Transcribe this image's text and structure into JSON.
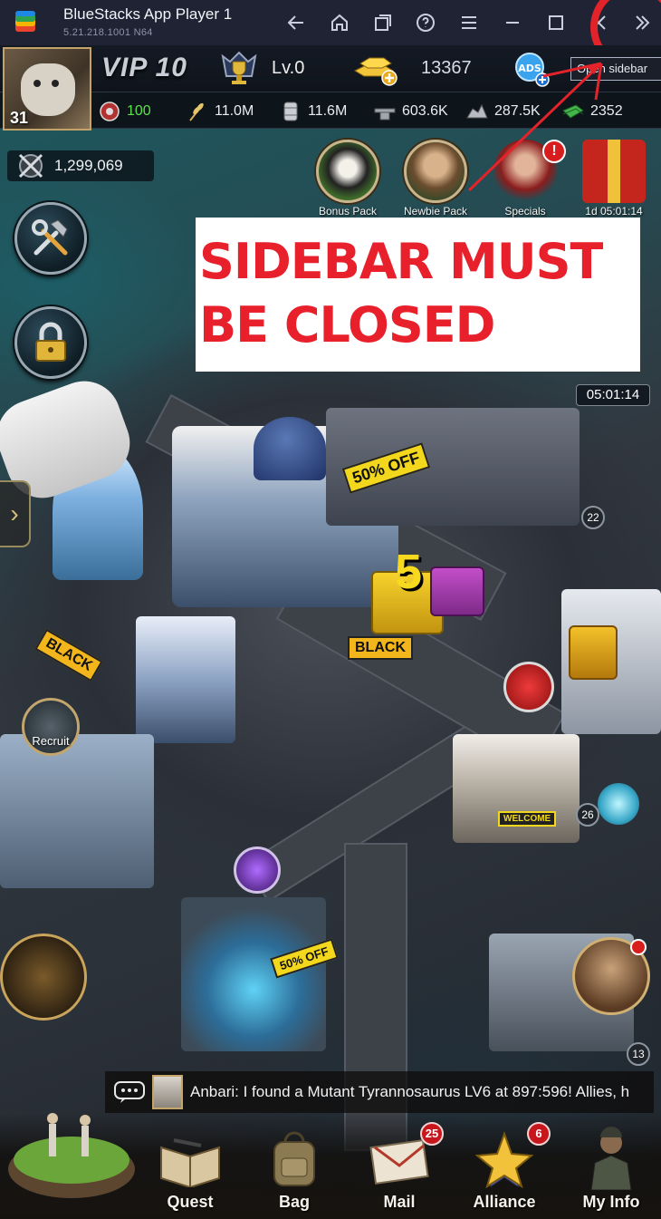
{
  "window": {
    "title": "BlueStacks App Player 1",
    "version": "5.21.218.1001  N64",
    "accent": "#1f2333"
  },
  "hud": {
    "avatar_level": "31",
    "vip": "VIP 10",
    "level": "Lv.0",
    "gold": "13367",
    "sidebar_tooltip": "Open sidebar"
  },
  "resources": [
    {
      "icon": "wheel-icon",
      "value": "100",
      "color": "#5ce04a"
    },
    {
      "icon": "wheat-icon",
      "value": "11.0M"
    },
    {
      "icon": "oil-barrel-icon",
      "value": "11.6M"
    },
    {
      "icon": "steel-icon",
      "value": "603.6K"
    },
    {
      "icon": "ore-icon",
      "value": "287.5K"
    },
    {
      "icon": "cash-icon",
      "value": "2352"
    }
  ],
  "power": "1,299,069",
  "packs": [
    {
      "label": "Bonus Pack"
    },
    {
      "label": "Newbie Pack"
    },
    {
      "label": "Specials"
    },
    {
      "label": "1d 05:01:14"
    }
  ],
  "alert": "!",
  "annotation": {
    "line1": "SIDEBAR MUST",
    "line2": "BE CLOSED",
    "color": "#e7202b"
  },
  "timer": "05:01:14",
  "map": {
    "banner_sale": "50% OFF",
    "banner_sale2": "50% OFF",
    "banner_black": "BLACK",
    "gift_count": "5",
    "recruit": "Recruit",
    "welcome": "WELCOME",
    "count_26": "26",
    "count_13": "13",
    "count_22": "22"
  },
  "chat": {
    "message": "Anbari: I found a Mutant Tyrannosaurus LV6 at 897:596! Allies, h"
  },
  "nav": [
    {
      "label": "Quest",
      "badge": ""
    },
    {
      "label": "Bag",
      "badge": ""
    },
    {
      "label": "Mail",
      "badge": "25"
    },
    {
      "label": "Alliance",
      "badge": "6"
    },
    {
      "label": "My Info",
      "badge": ""
    }
  ]
}
